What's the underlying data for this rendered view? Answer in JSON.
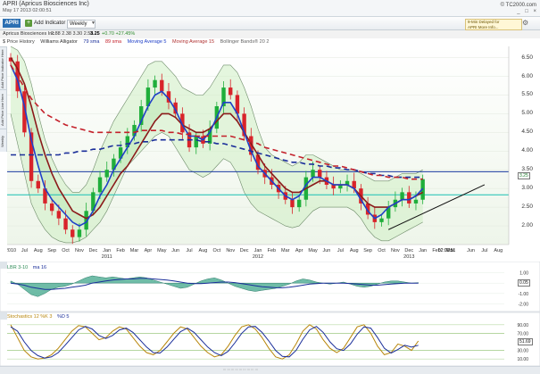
{
  "window": {
    "title": "APRI (Apricus Biosciences Inc)",
    "date": "May 17 2013 02:00:51",
    "brand": "© TC2000.com",
    "controls": "_ □ ×"
  },
  "toolbar": {
    "symbol": "APRI",
    "add_indicator": "Add Indicator",
    "timeframe": "Weekly",
    "delay_badge_line1": "9-Min Delayed for",
    "delay_badge_line2": "APRI More Info...",
    "gear_icon": "gear-icon"
  },
  "quote": {
    "name": "Apricus Biosciences Inc",
    "ohlc": "2.88  2.38  3.30  2.58",
    "last": "3.25",
    "change": "+0.70  +27.45%"
  },
  "legend": {
    "price_history": "$ Price History",
    "alligator": "Williams Alligator",
    "sma79": "79 sma",
    "sma89": "89 sma",
    "ma5": "Moving Average 5",
    "ma15": "Moving Average 15",
    "bollinger": "Bollinger Bands® 20 2"
  },
  "side_tabs": [
    "Add Price Indicator Here",
    "Add Price Line Here",
    "Weekly"
  ],
  "colors": {
    "up_candle": "#1fae3b",
    "down_candle": "#d8232a",
    "sma79": "#1b2f9a",
    "sma89": "#c4202a",
    "ma5": "#2040c8",
    "ma15": "#8b1a1a",
    "bollinger_fill": "#cfeec4",
    "alligator_fill": "#bfe8b8",
    "hline_blue": "#1b3aa0",
    "hline_cyan": "#19c0b4",
    "trendline": "#111111"
  },
  "chart_data": [
    {
      "type": "candlestick",
      "title": "APRI Weekly",
      "y_ticks": [
        "2.00",
        "2.50",
        "3.00",
        "3.50",
        "4.00",
        "4.50",
        "5.00",
        "5.50",
        "6.00",
        "6.50"
      ],
      "ylim": [
        1.5,
        6.8
      ],
      "x_ticks": [
        {
          "label": "2010",
          "x": 0
        },
        {
          "label": "Jul",
          "x": 2
        },
        {
          "label": "Aug",
          "x": 4
        },
        {
          "label": "Sep",
          "x": 6
        },
        {
          "label": "Oct",
          "x": 8
        },
        {
          "label": "Nov",
          "x": 10
        },
        {
          "label": "Dec",
          "x": 12
        },
        {
          "label": "Jan",
          "x": 14
        },
        {
          "label": "Feb",
          "x": 16
        },
        {
          "label": "Mar",
          "x": 18
        },
        {
          "label": "Apr",
          "x": 20
        },
        {
          "label": "May",
          "x": 22
        },
        {
          "label": "Jun",
          "x": 24
        },
        {
          "label": "Jul",
          "x": 26
        },
        {
          "label": "Aug",
          "x": 28
        },
        {
          "label": "Oct",
          "x": 30
        },
        {
          "label": "Nov",
          "x": 32
        },
        {
          "label": "Dec",
          "x": 34
        },
        {
          "label": "Jan",
          "x": 36
        },
        {
          "label": "Feb",
          "x": 38
        },
        {
          "label": "Mar",
          "x": 40
        },
        {
          "label": "Apr",
          "x": 42
        },
        {
          "label": "May",
          "x": 44
        },
        {
          "label": "Jun",
          "x": 46
        },
        {
          "label": "Jul",
          "x": 48
        },
        {
          "label": "Aug",
          "x": 50
        },
        {
          "label": "Sep",
          "x": 52
        },
        {
          "label": "Oct",
          "x": 54
        },
        {
          "label": "Nov",
          "x": 56
        },
        {
          "label": "Dec",
          "x": 58
        },
        {
          "label": "Jan",
          "x": 60
        },
        {
          "label": "Feb",
          "x": 62
        },
        {
          "label": "Mar",
          "x": 64
        },
        {
          "label": "Jun",
          "x": 67
        },
        {
          "label": "Jul",
          "x": 69
        },
        {
          "label": "Aug",
          "x": 71
        }
      ],
      "year_labels": [
        {
          "label": "2011",
          "x": 14
        },
        {
          "label": "2012",
          "x": 36
        },
        {
          "label": "2013",
          "x": 58
        }
      ],
      "x_cursor_label": "02:00:51",
      "closes": [
        6.4,
        5.6,
        4.5,
        3.2,
        3.0,
        2.6,
        2.4,
        2.2,
        1.9,
        1.7,
        1.9,
        2.4,
        2.9,
        3.3,
        3.5,
        3.8,
        4.1,
        4.4,
        4.7,
        5.2,
        5.7,
        5.9,
        5.6,
        5.3,
        5.0,
        4.5,
        4.1,
        4.4,
        4.2,
        4.6,
        5.2,
        5.7,
        5.5,
        5.0,
        4.4,
        3.9,
        3.5,
        3.3,
        3.1,
        2.9,
        2.7,
        2.5,
        2.7,
        3.3,
        3.5,
        3.3,
        3.1,
        3.0,
        3.1,
        3.2,
        3.0,
        2.6,
        2.3,
        2.1,
        2.2,
        2.5,
        2.7,
        2.9,
        2.6,
        2.7,
        3.25
      ],
      "ma5": [
        6.3,
        5.9,
        5.2,
        4.3,
        3.6,
        3.0,
        2.7,
        2.5,
        2.3,
        2.1,
        2.0,
        2.1,
        2.4,
        2.8,
        3.1,
        3.5,
        3.8,
        4.1,
        4.4,
        4.8,
        5.2,
        5.5,
        5.6,
        5.4,
        5.1,
        4.7,
        4.4,
        4.4,
        4.3,
        4.5,
        4.9,
        5.3,
        5.3,
        5.0,
        4.5,
        4.0,
        3.6,
        3.4,
        3.2,
        3.0,
        2.8,
        2.7,
        2.8,
        3.1,
        3.3,
        3.3,
        3.2,
        3.1,
        3.1,
        3.1,
        3.0,
        2.7,
        2.4,
        2.2,
        2.3,
        2.5,
        2.6,
        2.7,
        2.7,
        2.8,
        3.0
      ],
      "ma15": [
        6.5,
        6.2,
        5.8,
        5.2,
        4.5,
        3.9,
        3.4,
        3.0,
        2.7,
        2.4,
        2.3,
        2.2,
        2.3,
        2.5,
        2.8,
        3.1,
        3.4,
        3.6,
        3.9,
        4.2,
        4.5,
        4.8,
        5.0,
        5.0,
        4.9,
        4.7,
        4.6,
        4.5,
        4.5,
        4.6,
        4.8,
        5.0,
        5.0,
        4.8,
        4.5,
        4.2,
        3.9,
        3.6,
        3.4,
        3.2,
        3.0,
        2.9,
        2.9,
        3.0,
        3.1,
        3.2,
        3.2,
        3.1,
        3.1,
        3.1,
        3.0,
        2.8,
        2.6,
        2.5,
        2.5,
        2.5,
        2.6,
        2.7,
        2.7,
        2.8,
        2.9
      ],
      "sma79": [
        3.9,
        3.9,
        3.9,
        3.9,
        3.9,
        3.9,
        3.9,
        3.9,
        3.95,
        3.95,
        4.0,
        4.0,
        4.05,
        4.05,
        4.1,
        4.15,
        4.15,
        4.2,
        4.2,
        4.25,
        4.25,
        4.3,
        4.3,
        4.3,
        4.3,
        4.3,
        4.3,
        4.3,
        4.25,
        4.25,
        4.2,
        4.2,
        4.15,
        4.1,
        4.05,
        4.0,
        3.95,
        3.9,
        3.85,
        3.8,
        3.75,
        3.7,
        3.7,
        3.65,
        3.65,
        3.6,
        3.6,
        3.55,
        3.55,
        3.5,
        3.5,
        3.45,
        3.4,
        3.4,
        3.35,
        3.35,
        3.3,
        3.3,
        3.3,
        3.3,
        3.3
      ],
      "sma89": [
        6.3,
        6.0,
        5.7,
        5.4,
        5.2,
        5.0,
        4.9,
        4.8,
        4.7,
        4.65,
        4.6,
        4.55,
        4.5,
        4.5,
        4.5,
        4.5,
        4.5,
        4.5,
        4.5,
        4.55,
        4.55,
        4.55,
        4.55,
        4.5,
        4.5,
        4.45,
        4.45,
        4.4,
        4.4,
        4.4,
        4.4,
        4.4,
        4.4,
        4.35,
        4.3,
        4.25,
        4.2,
        4.1,
        4.05,
        4.0,
        3.95,
        3.9,
        3.85,
        3.8,
        3.75,
        3.7,
        3.65,
        3.6,
        3.6,
        3.55,
        3.5,
        3.45,
        3.4,
        3.35,
        3.35,
        3.3,
        3.3,
        3.3,
        3.25,
        3.25,
        3.25
      ],
      "bb_upper": [
        6.8,
        6.7,
        6.4,
        5.8,
        5.0,
        4.3,
        3.8,
        3.4,
        3.1,
        2.9,
        2.9,
        3.1,
        3.5,
        4.0,
        4.4,
        4.8,
        5.1,
        5.4,
        5.7,
        6.0,
        6.3,
        6.4,
        6.4,
        6.2,
        6.0,
        5.7,
        5.6,
        5.5,
        5.5,
        5.7,
        6.0,
        6.3,
        6.3,
        6.1,
        5.7,
        5.2,
        4.6,
        4.1,
        3.9,
        3.8,
        3.7,
        3.6,
        3.7,
        3.9,
        3.9,
        3.8,
        3.7,
        3.6,
        3.5,
        3.5,
        3.5,
        3.4,
        3.3,
        3.2,
        3.2,
        3.2,
        3.3,
        3.4,
        3.4,
        3.4,
        3.5
      ],
      "bb_lower": [
        5.0,
        4.2,
        3.4,
        2.6,
        2.2,
        1.9,
        1.7,
        1.6,
        1.55,
        1.55,
        1.6,
        1.7,
        1.9,
        2.1,
        2.4,
        2.8,
        3.2,
        3.6,
        3.8,
        4.0,
        4.2,
        4.4,
        4.5,
        4.4,
        4.1,
        3.8,
        3.5,
        3.4,
        3.3,
        3.4,
        3.6,
        3.8,
        3.7,
        3.4,
        2.9,
        2.6,
        2.4,
        2.3,
        2.2,
        2.1,
        2.0,
        1.95,
        2.0,
        2.2,
        2.4,
        2.5,
        2.5,
        2.5,
        2.5,
        2.5,
        2.4,
        2.2,
        1.9,
        1.7,
        1.6,
        1.6,
        1.7,
        1.8,
        1.9,
        2.0,
        2.1
      ],
      "hline_blue": 3.45,
      "hline_cyan": 2.83,
      "price_label": "3.25",
      "trendline": {
        "x1": 55,
        "y1": 1.9,
        "x2": 69,
        "y2": 3.1
      }
    },
    {
      "type": "area",
      "title": "LBR 3-10",
      "legend": [
        "LBR 3-10",
        "ma 16"
      ],
      "y_ticks": [
        "1.00",
        "0.00",
        "-1.00",
        "-2.00"
      ],
      "ylim": [
        -2.3,
        1.3
      ],
      "value_label": "0.05",
      "values": [
        0.2,
        -0.1,
        -0.6,
        -1.1,
        -1.3,
        -1.0,
        -0.6,
        -0.4,
        -0.3,
        -0.1,
        0.2,
        0.5,
        0.7,
        0.6,
        0.5,
        0.6,
        0.5,
        0.4,
        0.5,
        0.6,
        0.5,
        0.3,
        0.1,
        -0.1,
        -0.3,
        -0.5,
        -0.4,
        -0.1,
        0.2,
        0.4,
        0.5,
        0.3,
        0.0,
        -0.3,
        -0.5,
        -0.7,
        -0.8,
        -0.7,
        -0.6,
        -0.5,
        -0.3,
        -0.1,
        0.2,
        0.4,
        0.3,
        0.1,
        0.0,
        -0.1,
        0.0,
        0.1,
        -0.1,
        -0.3,
        -0.4,
        -0.3,
        -0.1,
        0.1,
        0.2,
        0.2,
        0.1,
        0.0,
        0.05
      ],
      "ma16": [
        0.0,
        -0.1,
        -0.2,
        -0.4,
        -0.5,
        -0.6,
        -0.6,
        -0.55,
        -0.5,
        -0.4,
        -0.3,
        -0.2,
        0.0,
        0.1,
        0.2,
        0.3,
        0.35,
        0.4,
        0.4,
        0.45,
        0.45,
        0.4,
        0.35,
        0.3,
        0.2,
        0.1,
        0.0,
        -0.05,
        -0.05,
        0.0,
        0.05,
        0.1,
        0.1,
        0.05,
        -0.05,
        -0.15,
        -0.25,
        -0.35,
        -0.4,
        -0.45,
        -0.45,
        -0.4,
        -0.3,
        -0.2,
        -0.1,
        -0.05,
        0.0,
        0.0,
        0.0,
        0.0,
        -0.05,
        -0.1,
        -0.15,
        -0.2,
        -0.2,
        -0.15,
        -0.1,
        -0.05,
        0.0,
        0.0,
        0.0
      ]
    },
    {
      "type": "line",
      "title": "Stochastics 12 %K 3",
      "legend": [
        "Stochastics 12 %K 3",
        "%D 5"
      ],
      "y_ticks": [
        "90.00",
        "70.00",
        "30.00",
        "10.00"
      ],
      "ylim": [
        0,
        100
      ],
      "value_label": "51.69",
      "k": [
        90,
        60,
        30,
        15,
        10,
        12,
        20,
        35,
        55,
        75,
        88,
        85,
        70,
        55,
        60,
        75,
        85,
        80,
        60,
        40,
        25,
        20,
        30,
        50,
        70,
        85,
        80,
        60,
        40,
        25,
        15,
        20,
        40,
        65,
        85,
        90,
        80,
        60,
        35,
        15,
        10,
        20,
        45,
        75,
        90,
        80,
        55,
        35,
        25,
        35,
        60,
        85,
        90,
        70,
        40,
        20,
        25,
        45,
        40,
        30,
        52
      ],
      "d": [
        85,
        75,
        50,
        30,
        18,
        12,
        15,
        25,
        42,
        60,
        78,
        86,
        80,
        65,
        58,
        65,
        78,
        82,
        72,
        55,
        38,
        25,
        24,
        38,
        56,
        74,
        82,
        72,
        55,
        38,
        25,
        18,
        28,
        48,
        70,
        85,
        86,
        72,
        52,
        30,
        16,
        15,
        30,
        56,
        78,
        86,
        72,
        50,
        34,
        30,
        45,
        68,
        85,
        82,
        60,
        35,
        24,
        32,
        42,
        38,
        42
      ]
    }
  ],
  "bottom_bar": "::: ::: ::: ::: ::: ::: ::: ::: :::"
}
